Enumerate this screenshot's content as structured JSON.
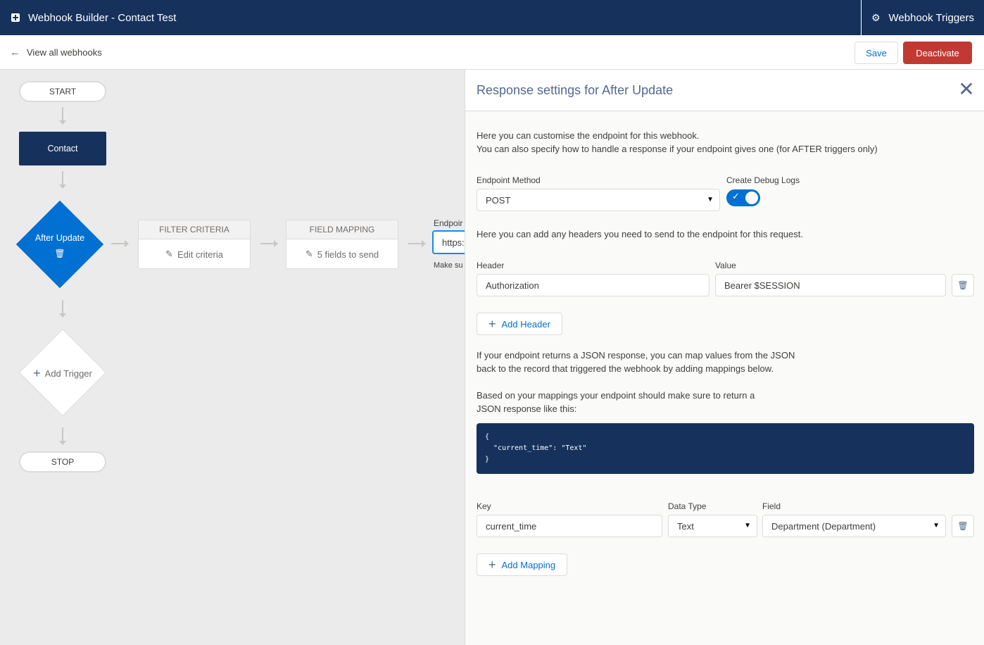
{
  "topbar": {
    "app_title": "Webhook Builder - Contact Test",
    "triggers_label": "Webhook Triggers",
    "gear_glyph": "⚙"
  },
  "subbar": {
    "back_label": "View all webhooks",
    "save_label": "Save",
    "deactivate_label": "Deactivate"
  },
  "flow": {
    "start_label": "START",
    "object_label": "Contact",
    "trigger_label": "After Update",
    "add_trigger_label": "Add Trigger",
    "stop_label": "STOP",
    "filter": {
      "header": "FILTER CRITERIA",
      "action": "Edit criteria"
    },
    "mapping": {
      "header": "FIELD MAPPING",
      "action": "5 fields to send"
    },
    "endpoint": {
      "label": "Endpoir",
      "value": "https:",
      "hint": "Make su"
    }
  },
  "panel": {
    "title": "Response settings for After Update",
    "close_glyph": "✕",
    "intro_line1": "Here you can customise the endpoint for this webhook.",
    "intro_line2": "You can also specify how to handle a response if your endpoint gives one (for AFTER triggers only)",
    "method_label": "Endpoint Method",
    "method_value": "POST",
    "debug_label": "Create Debug Logs",
    "debug_enabled": true,
    "headers_intro": "Here you can add any headers you need to send to the endpoint for this request.",
    "header_col_label": "Header",
    "value_col_label": "Value",
    "headers": [
      {
        "header": "Authorization",
        "value": "Bearer $SESSION"
      }
    ],
    "add_header_label": "Add Header",
    "json_intro_line1": "If your endpoint returns a JSON response, you can map values from the JSON",
    "json_intro_line2": "back to the record that triggered the webhook by adding mappings below.",
    "json_expect_line1": "Based on your mappings your endpoint should make sure to return a",
    "json_expect_line2": "JSON response like this:",
    "json_example": "{\n  \"current_time\": \"Text\"\n}",
    "key_col_label": "Key",
    "type_col_label": "Data Type",
    "field_col_label": "Field",
    "mappings": [
      {
        "key": "current_time",
        "type": "Text",
        "field": "Department (Department)"
      }
    ],
    "add_mapping_label": "Add Mapping"
  },
  "colors": {
    "brand_navy": "#16325c",
    "brand_blue": "#0070d2",
    "danger": "#c23934"
  }
}
